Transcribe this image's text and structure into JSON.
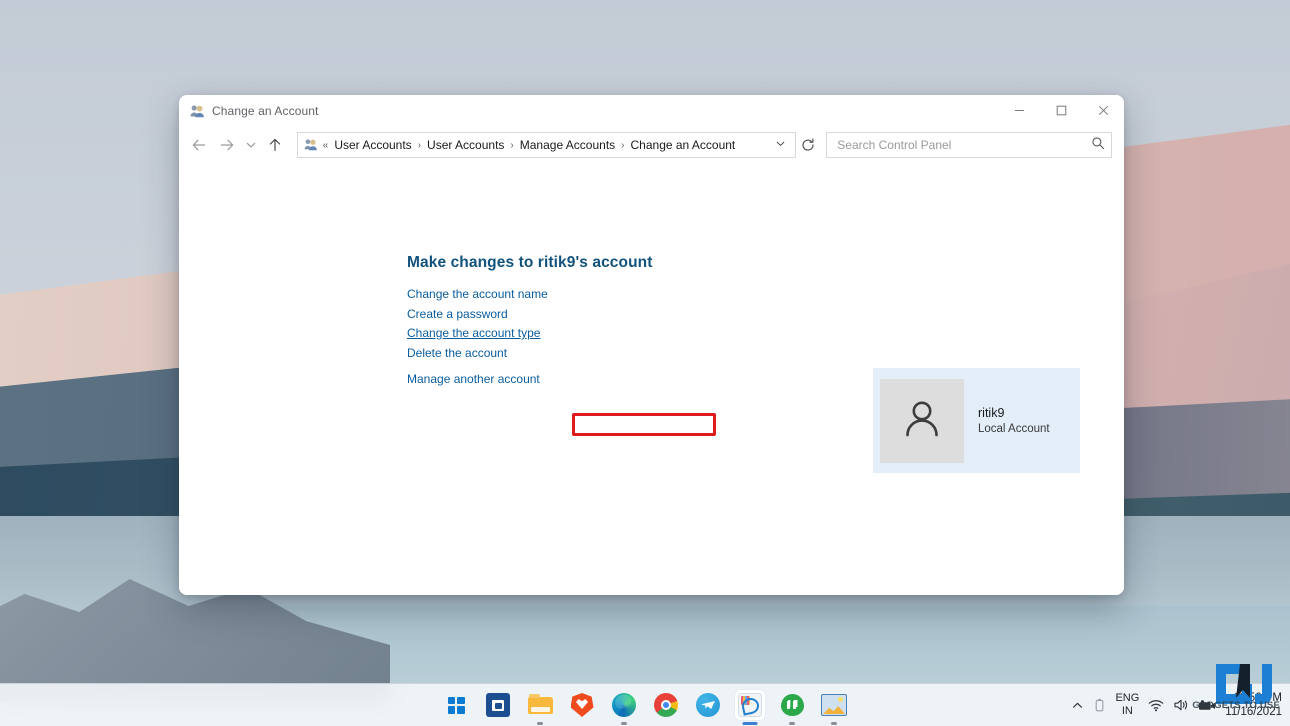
{
  "window": {
    "title": "Change an Account",
    "title_icon": "user-accounts-icon",
    "controls": {
      "minimize": "—",
      "maximize": "□",
      "close": "✕"
    }
  },
  "nav": {
    "back": "←",
    "forward": "→",
    "recent": "˅",
    "up": "↑",
    "refresh": "↻",
    "dropdown": "˅"
  },
  "address": {
    "icon": "user-accounts-icon",
    "prefix": "«",
    "separator": "›",
    "crumbs": [
      "User Accounts",
      "User Accounts",
      "Manage Accounts",
      "Change an Account"
    ]
  },
  "search": {
    "placeholder": "Search Control Panel",
    "value": "",
    "icon": "search-icon"
  },
  "main": {
    "heading": "Make changes to ritik9's account",
    "tasks": [
      {
        "label": "Change the account name",
        "highlighted": false
      },
      {
        "label": "Create a password",
        "highlighted": false
      },
      {
        "label": "Change the account type",
        "highlighted": true
      },
      {
        "label": "Delete the account",
        "highlighted": false
      }
    ],
    "manage_another": "Manage another account",
    "highlight_color": "#e01b20"
  },
  "user_panel": {
    "avatar_icon": "person-icon",
    "name": "ritik9",
    "account_type": "Local Account",
    "background": "#e3eef8"
  },
  "taskbar": {
    "items": [
      {
        "name": "start",
        "icon": "windows-start-icon",
        "active": false,
        "running": false
      },
      {
        "name": "microsoft-store",
        "icon": "store-icon",
        "active": false,
        "running": false
      },
      {
        "name": "file-explorer",
        "icon": "folder-icon",
        "active": false,
        "running": true
      },
      {
        "name": "brave",
        "icon": "brave-icon",
        "active": false,
        "running": false
      },
      {
        "name": "edge",
        "icon": "edge-icon",
        "active": false,
        "running": true
      },
      {
        "name": "chrome",
        "icon": "chrome-icon",
        "active": false,
        "running": false
      },
      {
        "name": "telegram",
        "icon": "telegram-icon",
        "active": false,
        "running": false
      },
      {
        "name": "snipping-tool",
        "icon": "snipping-tool-icon",
        "active": true,
        "running": true
      },
      {
        "name": "green-app",
        "icon": "quotes-app-icon",
        "active": false,
        "running": true
      },
      {
        "name": "photo-app",
        "icon": "picture-app-icon",
        "active": false,
        "running": true
      }
    ],
    "tray": {
      "chevron": "∧",
      "battery": "battery-icon",
      "language_line1": "ENG",
      "language_line2": "IN",
      "wifi": "wifi-icon",
      "volume": "volume-icon",
      "camera": "camera-icon",
      "time": "11:56 PM",
      "date": "11/16/2021"
    }
  },
  "watermark": {
    "text": "GADGETS TO USE",
    "logo": "gj-logo",
    "color": "#1c7fd4"
  }
}
